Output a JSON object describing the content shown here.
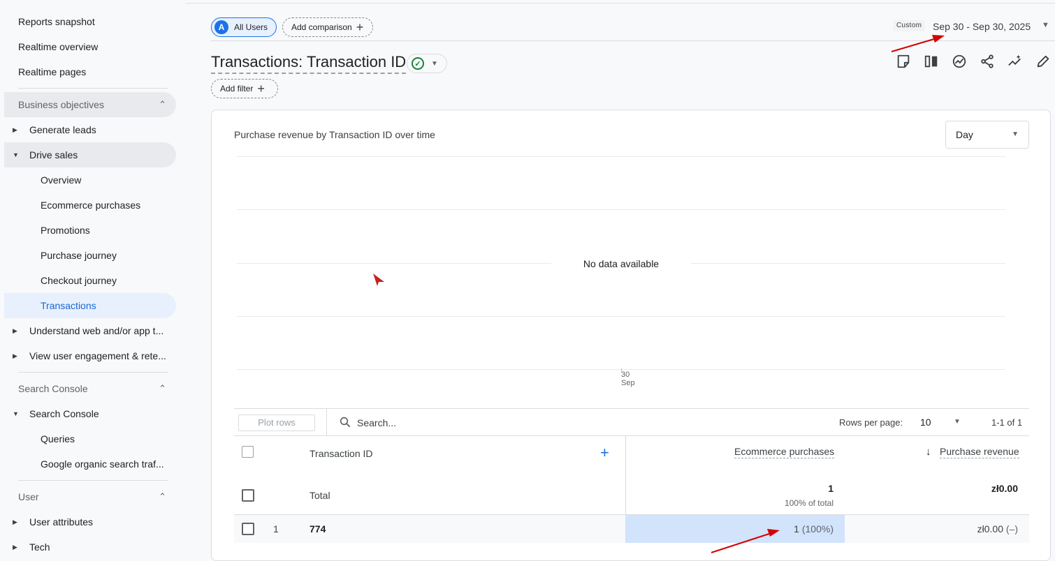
{
  "sidebar": {
    "top_items": [
      "Reports snapshot",
      "Realtime overview",
      "Realtime pages"
    ],
    "sections": [
      {
        "title": "Business objectives",
        "groups": [
          {
            "label": "Generate leads",
            "expanded": false,
            "items": []
          },
          {
            "label": "Drive sales",
            "expanded": true,
            "items": [
              "Overview",
              "Ecommerce purchases",
              "Promotions",
              "Purchase journey",
              "Checkout journey",
              "Transactions"
            ]
          },
          {
            "label": "Understand web and/or app t...",
            "expanded": false,
            "items": []
          },
          {
            "label": "View user engagement & rete...",
            "expanded": false,
            "items": []
          }
        ]
      },
      {
        "title": "Search Console",
        "groups": [
          {
            "label": "Search Console",
            "expanded": true,
            "items": [
              "Queries",
              "Google organic search traf..."
            ]
          }
        ]
      },
      {
        "title": "User",
        "groups": [
          {
            "label": "User attributes",
            "expanded": false,
            "items": []
          },
          {
            "label": "Tech",
            "expanded": false,
            "items": []
          }
        ]
      }
    ],
    "selected_item": "Transactions"
  },
  "header": {
    "segment_avatar": "A",
    "segment_label": "All Users",
    "add_comparison": "Add comparison",
    "add_filter": "Add filter",
    "date_tag": "Custom",
    "date_range": "Sep 30 - Sep 30, 2025",
    "title": "Transactions: Transaction ID"
  },
  "toolbar_icons": [
    "note-icon",
    "compare-columns-icon",
    "insights-icon",
    "share-icon",
    "sparkle-trend-icon",
    "edit-icon"
  ],
  "chart": {
    "title": "Purchase revenue by Transaction ID over time",
    "granularity": "Day",
    "empty_message": "No data available",
    "x_tick_day": "30",
    "x_tick_month": "Sep"
  },
  "chart_data": {
    "type": "line",
    "title": "Purchase revenue by Transaction ID over time",
    "x": [
      "30 Sep"
    ],
    "series": [],
    "xlabel": "",
    "ylabel": "",
    "grid": true
  },
  "table": {
    "plot_rows": "Plot rows",
    "search_placeholder": "Search...",
    "rows_per_page_label": "Rows per page:",
    "rows_per_page": "10",
    "page_info": "1-1 of 1",
    "dimension_header": "Transaction ID",
    "metric_headers": [
      "Ecommerce purchases",
      "Purchase revenue"
    ],
    "total_label": "Total",
    "totals": {
      "purchases": "1",
      "purchases_pct": "100% of total",
      "revenue": "zł0.00"
    },
    "rows": [
      {
        "num": "1",
        "id": "774",
        "purchases": "1",
        "purchases_pct": "(100%)",
        "revenue": "zł0.00",
        "revenue_pct": "(–)"
      }
    ]
  },
  "colors": {
    "accent": "#1a73e8",
    "selected_bg": "#e8f0fe",
    "highlight_cell": "#d2e3fc",
    "annotation_arrow": "#d50000"
  }
}
